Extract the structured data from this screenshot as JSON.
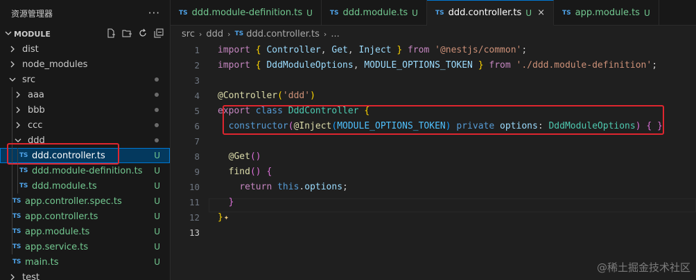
{
  "sidebar": {
    "title": "资源管理器",
    "more": "···",
    "section": "MODULE",
    "items": [
      {
        "label": "dist",
        "type": "folder",
        "open": false,
        "depth": 0
      },
      {
        "label": "node_modules",
        "type": "folder",
        "open": false,
        "depth": 0
      },
      {
        "label": "src",
        "type": "folder",
        "open": true,
        "depth": 0,
        "dot": true
      },
      {
        "label": "aaa",
        "type": "folder",
        "open": false,
        "depth": 1,
        "dot": true
      },
      {
        "label": "bbb",
        "type": "folder",
        "open": false,
        "depth": 1,
        "dot": true
      },
      {
        "label": "ccc",
        "type": "folder",
        "open": false,
        "depth": 1,
        "dot": true
      },
      {
        "label": "ddd",
        "type": "folder",
        "open": true,
        "depth": 1,
        "dot": true
      },
      {
        "label": "ddd.controller.ts",
        "type": "ts",
        "depth": 2,
        "badge": "U",
        "selected": true
      },
      {
        "label": "ddd.module-definition.ts",
        "type": "ts",
        "depth": 2,
        "badge": "U"
      },
      {
        "label": "ddd.module.ts",
        "type": "ts",
        "depth": 2,
        "badge": "U"
      },
      {
        "label": "app.controller.spec.ts",
        "type": "ts",
        "depth": 1,
        "badge": "U"
      },
      {
        "label": "app.controller.ts",
        "type": "ts",
        "depth": 1,
        "badge": "U"
      },
      {
        "label": "app.module.ts",
        "type": "ts",
        "depth": 1,
        "badge": "U"
      },
      {
        "label": "app.service.ts",
        "type": "ts",
        "depth": 1,
        "badge": "U"
      },
      {
        "label": "main.ts",
        "type": "ts",
        "depth": 1,
        "badge": "U"
      },
      {
        "label": "test",
        "type": "folder",
        "open": false,
        "depth": 0
      }
    ]
  },
  "tabs": [
    {
      "label": "ddd.module-definition.ts",
      "mod": "U",
      "active": false
    },
    {
      "label": "ddd.module.ts",
      "mod": "U",
      "active": false
    },
    {
      "label": "ddd.controller.ts",
      "mod": "U",
      "active": true
    },
    {
      "label": "app.module.ts",
      "mod": "U",
      "active": false
    }
  ],
  "tab_icon": "TS",
  "tab_close": "×",
  "breadcrumb": {
    "parts": [
      "src",
      "ddd",
      "ddd.controller.ts",
      "..."
    ]
  },
  "code": {
    "line_numbers": [
      "1",
      "2",
      "3",
      "4",
      "5",
      "6",
      "7",
      "8",
      "9",
      "10",
      "11",
      "12",
      "13"
    ],
    "current_line": 13
  },
  "watermark": "@稀土掘金技术社区",
  "colors": {
    "accent": "#0078d4",
    "modified": "#73c991",
    "highlight_box": "#e0262f"
  }
}
